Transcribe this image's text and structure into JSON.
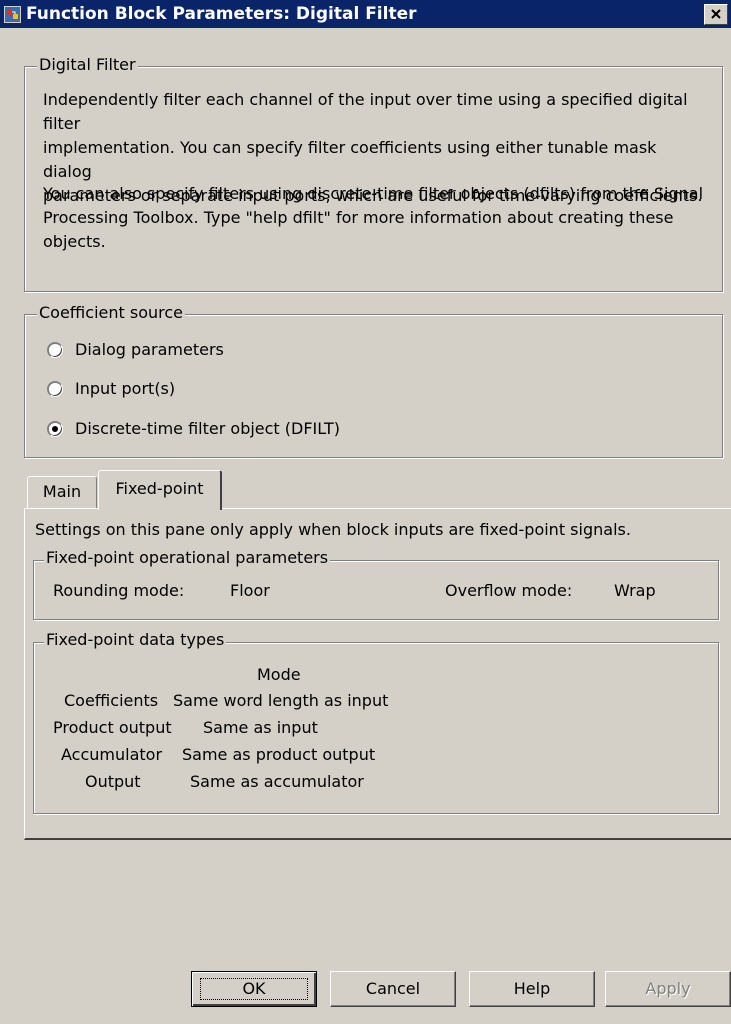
{
  "window": {
    "title": "Function Block Parameters: Digital Filter",
    "close_glyph": "×",
    "icon": "simulink-block-icon"
  },
  "description_group": {
    "legend": "Digital Filter",
    "paragraph1_lines": [
      "Independently filter each channel of the input over time using a specified digital filter",
      "implementation. You can specify filter coefficients using either tunable mask dialog",
      "parameters or separate input ports, which are useful for time-varying coefficients."
    ],
    "paragraph2_lines": [
      "You can also specify filters using discrete-time filter objects (dfilts) from the Signal",
      "Processing Toolbox. Type \"help dfilt\" for more information about creating these",
      "objects."
    ]
  },
  "coefficient_source": {
    "legend": "Coefficient source",
    "options": [
      {
        "label": "Dialog parameters",
        "selected": false
      },
      {
        "label": "Input port(s)",
        "selected": false
      },
      {
        "label": "Discrete-time filter object (DFILT)",
        "selected": true
      }
    ]
  },
  "tabs": [
    {
      "label": "Main",
      "active": false
    },
    {
      "label": "Fixed-point",
      "active": true
    }
  ],
  "fixed_point_pane": {
    "intro": "Settings on this pane only apply when block inputs are fixed-point signals.",
    "operational": {
      "legend": "Fixed-point operational parameters",
      "rounding_label": "Rounding mode:",
      "rounding_value": "Floor",
      "overflow_label": "Overflow mode:",
      "overflow_value": "Wrap"
    },
    "data_types": {
      "legend": "Fixed-point data types",
      "mode_header": "Mode",
      "rows": [
        {
          "name": "Coefficients",
          "mode": "Same word length as input"
        },
        {
          "name": "Product output",
          "mode": "Same as input"
        },
        {
          "name": "Accumulator",
          "mode": "Same as product output"
        },
        {
          "name": "Output",
          "mode": "Same as accumulator"
        }
      ]
    }
  },
  "buttons": {
    "ok": "OK",
    "cancel": "Cancel",
    "help": "Help",
    "apply": "Apply"
  }
}
